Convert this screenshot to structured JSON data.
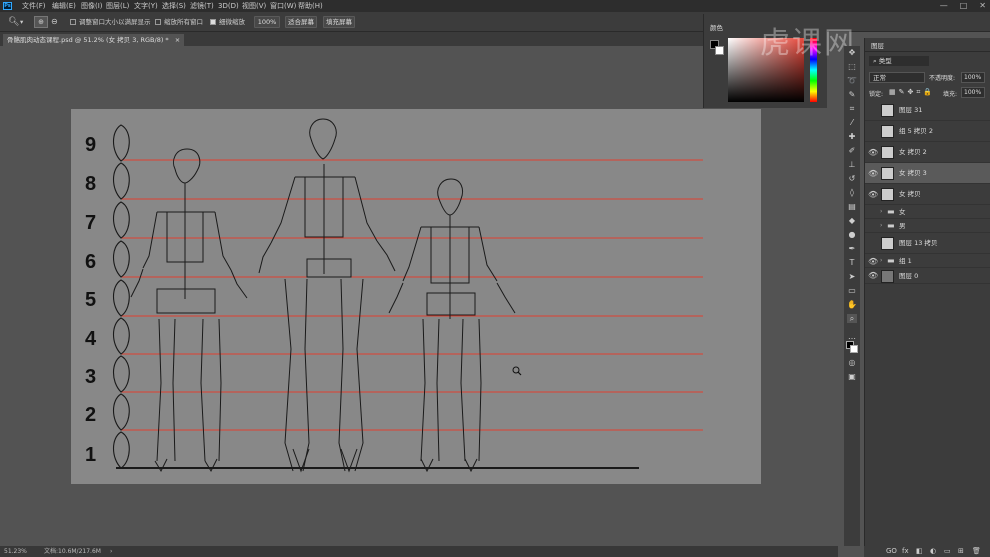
{
  "app": {
    "logo": "Ps"
  },
  "menu": [
    "文件(F)",
    "编辑(E)",
    "图像(I)",
    "图层(L)",
    "文字(Y)",
    "选择(S)",
    "滤镜(T)",
    "3D(D)",
    "视图(V)",
    "窗口(W)",
    "帮助(H)"
  ],
  "window_controls": {
    "minimize": "—",
    "maximize": "□",
    "close": "✕"
  },
  "options": {
    "resize_windows": "调整窗口大小以满屏显示",
    "zoom_all": "缩放所有窗口",
    "scrubby_zoom": "细微缩放",
    "zoom_percent": "100%",
    "fit_screen": "适合屏幕",
    "fill_screen": "填充屏幕"
  },
  "document_tab": {
    "title": "骨骼肌肉动态课程.psd @ 51.2% (女 拷贝 3, RGB/8) *",
    "close": "×"
  },
  "canvas": {
    "scale_numbers": [
      "9",
      "8",
      "7",
      "6",
      "5",
      "4",
      "3",
      "2",
      "1"
    ],
    "colors": {
      "guide": "#e04030",
      "paper": "#888888",
      "ink": "#1a1a1a"
    }
  },
  "status": {
    "zoom": "51.23%",
    "doc": "文档:10.6M/217.6M"
  },
  "color_panel": {
    "title": "颜色"
  },
  "watermark": "虎课网",
  "layers_panel": {
    "tab": "图层",
    "kind_label": "类型",
    "blend_mode": "正常",
    "opacity_label": "不透明度:",
    "opacity_value": "100%",
    "lock_label": "锁定:",
    "fill_label": "填充:",
    "fill_value": "100%",
    "layers": [
      {
        "name": "图层 31",
        "visible": false,
        "type": "pixel"
      },
      {
        "name": "组 5 拷贝 2",
        "visible": false,
        "type": "pixel"
      },
      {
        "name": "女 拷贝 2",
        "visible": true,
        "type": "pixel"
      },
      {
        "name": "女 拷贝 3",
        "visible": true,
        "type": "pixel",
        "selected": true
      },
      {
        "name": "女 拷贝",
        "visible": true,
        "type": "pixel"
      },
      {
        "name": "女",
        "visible": false,
        "type": "group"
      },
      {
        "name": "男",
        "visible": false,
        "type": "group"
      },
      {
        "name": "图层 13 拷贝",
        "visible": false,
        "type": "pixel"
      },
      {
        "name": "组 1",
        "visible": true,
        "type": "group"
      },
      {
        "name": "图层 0",
        "visible": true,
        "type": "pixel"
      }
    ]
  },
  "layer_bottom_icons": [
    "GO",
    "fx",
    "◧",
    "◐",
    "▭",
    "⊞",
    "🗑"
  ],
  "tool_icons": [
    "move-icon",
    "marquee-icon",
    "lasso-icon",
    "quick-select-icon",
    "crop-icon",
    "eyedropper-icon",
    "healing-icon",
    "brush-icon",
    "stamp-icon",
    "history-brush-icon",
    "eraser-icon",
    "gradient-icon",
    "blur-icon",
    "dodge-icon",
    "pen-icon",
    "type-icon",
    "path-select-icon",
    "shape-icon",
    "hand-icon",
    "zoom-icon"
  ]
}
